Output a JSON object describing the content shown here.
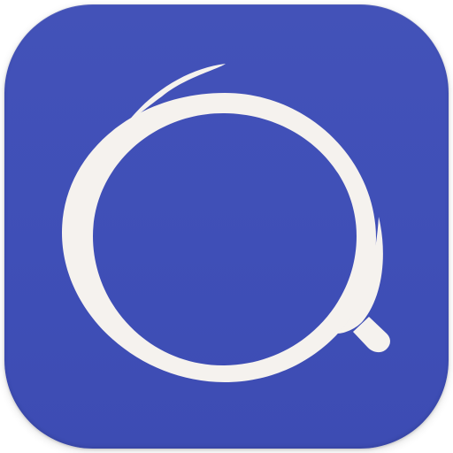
{
  "app_icon": {
    "icon": "magnifying-glass-icon",
    "colors": {
      "background": "#4151b8",
      "glyph": "#f5f2ee"
    }
  }
}
